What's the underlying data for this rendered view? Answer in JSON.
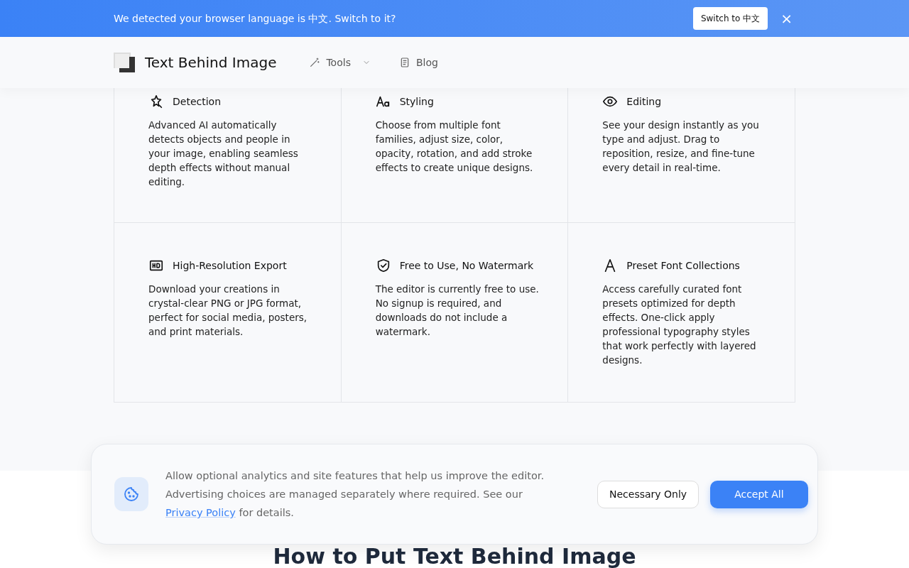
{
  "language_banner": {
    "message": "We detected your browser language is 中文. Switch to it?",
    "switch_button": "Switch to 中文",
    "close": "×"
  },
  "navbar": {
    "brand": "Text Behind Image",
    "links": [
      {
        "label": "Tools",
        "kind": "dropdown"
      },
      {
        "label": "Blog",
        "kind": "link"
      }
    ]
  },
  "features": [
    {
      "kind": "sparkle",
      "title": "Detection",
      "description": "Advanced AI automatically detects objects and people in your image, enabling seamless depth effects without manual editing."
    },
    {
      "kind": "fonts",
      "title": "Styling",
      "description": "Choose from multiple font families, adjust size, color, opacity, rotation, and add stroke effects to create unique designs."
    },
    {
      "kind": "eye",
      "title": "Editing",
      "description": "See your design instantly as you type and adjust. Drag to reposition, resize, and fine-tune every detail in real-time."
    },
    {
      "kind": "hd",
      "title": "High-Resolution Export",
      "description": "Download your creations in crystal-clear PNG or JPG format, perfect for social media, posters, and print materials."
    },
    {
      "kind": "shield",
      "title": "Free to Use, No Watermark",
      "description": "The editor is currently free to use. No signup is required, and downloads do not include a watermark."
    },
    {
      "kind": "letter",
      "title": "Preset Font Collections",
      "description": "Access carefully curated font presets optimized for depth effects. One-click apply professional typography styles that work perfectly with layered designs."
    }
  ],
  "cookie_banner": {
    "text_before": "Allow optional analytics and site features that help us improve the editor. Advertising choices are managed separately where required. See our",
    "link": "Privacy Policy",
    "text_after": "for details.",
    "buttons": [
      {
        "label": "Necessary Only",
        "kind": "secondary"
      },
      {
        "label": "Accept All",
        "kind": "primary"
      }
    ]
  },
  "section_heading": "How to Put Text Behind Image"
}
